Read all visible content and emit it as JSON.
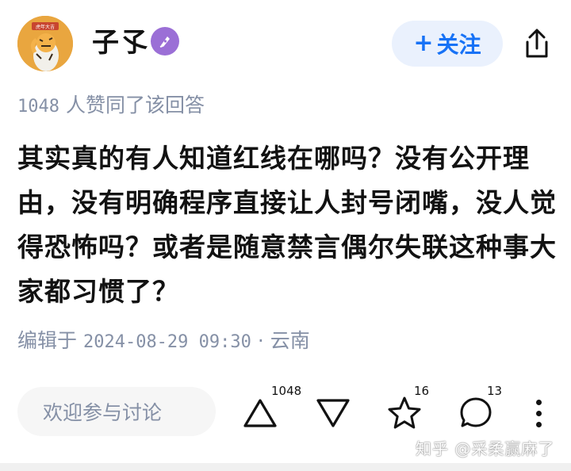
{
  "author": {
    "name": "子孓",
    "avatar_text": "虎年大吉",
    "badge_icon": "pen-icon"
  },
  "header": {
    "follow_label": "关注",
    "follow_plus": "+",
    "share_icon": "share-icon"
  },
  "answer": {
    "likes_count": "1048",
    "likes_suffix": "人赞同了该回答",
    "content": "其实真的有人知道红线在哪吗？没有公开理由，没有明确程序直接让人封号闭嘴，没人觉得恐怖吗？或者是随意禁言偶尔失联这种事大家都习惯了？",
    "edit_prefix": "编辑于",
    "edit_time": "2024-08-29 09:30",
    "edit_separator": "·",
    "location": "云南"
  },
  "actions": {
    "comment_placeholder": "欢迎参与讨论",
    "upvote_count": "1048",
    "downvote_count": "",
    "favorite_count": "16",
    "comment_count": "13"
  },
  "watermark": "知乎 @采柔赢麻了",
  "colors": {
    "accent": "#1772f6",
    "muted": "#8590a6",
    "badge": "#9b6fd6"
  }
}
